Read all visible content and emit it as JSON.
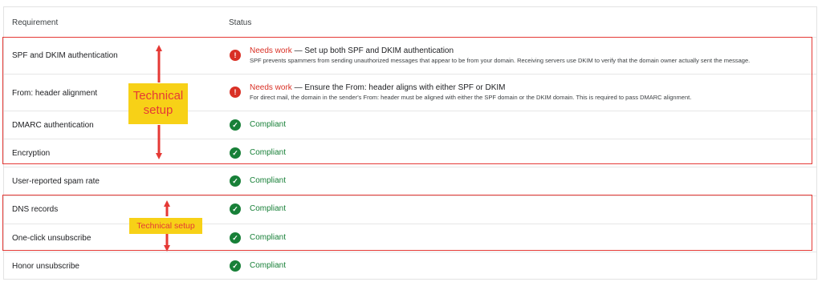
{
  "header": {
    "requirement": "Requirement",
    "status": "Status"
  },
  "rows": [
    {
      "requirement": "SPF and DKIM authentication",
      "status": "Needs work",
      "detail_title": "Set up both SPF and DKIM authentication",
      "description": "SPF prevents spammers from sending unauthorized messages that appear to be from your domain. Receiving servers use DKIM to verify that the domain owner actually sent the message."
    },
    {
      "requirement": "From: header alignment",
      "status": "Needs work",
      "detail_title": "Ensure the From: header aligns with either SPF or DKIM",
      "description": "For direct mail, the domain in the sender's From: header must be aligned with either the SPF domain or the DKIM domain. This is required to pass DMARC alignment."
    },
    {
      "requirement": "DMARC authentication",
      "status": "Compliant"
    },
    {
      "requirement": "Encryption",
      "status": "Compliant"
    },
    {
      "requirement": "User-reported spam rate",
      "status": "Compliant"
    },
    {
      "requirement": "DNS records",
      "status": "Compliant"
    },
    {
      "requirement": "One-click unsubscribe",
      "status": "Compliant"
    },
    {
      "requirement": "Honor unsubscribe",
      "status": "Compliant"
    }
  ],
  "separator": "—",
  "annotations": {
    "callout_large": [
      "Technical",
      "setup"
    ],
    "callout_small": "Technical setup"
  },
  "colors": {
    "compliant": "#188038",
    "needs_work": "#d93025",
    "annotation_red": "#e53935",
    "callout_yellow": "#f7d117"
  },
  "icons": {
    "compliant": "check-circle-icon",
    "needs_work": "error-circle-icon"
  }
}
